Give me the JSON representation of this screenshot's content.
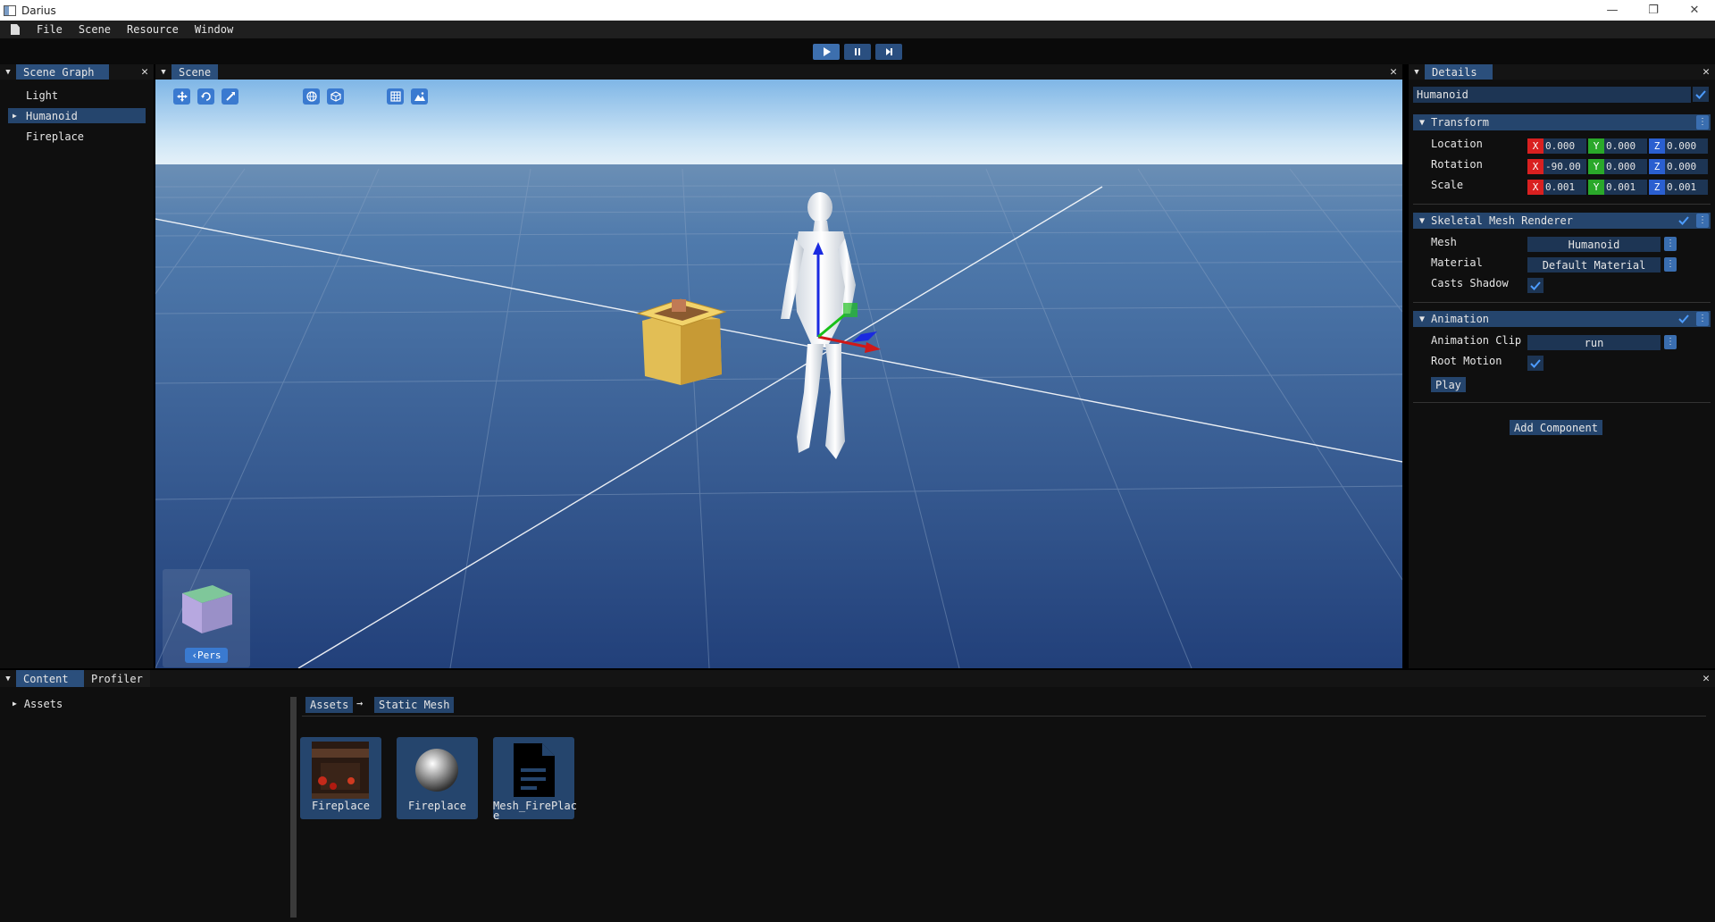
{
  "window": {
    "title": "Darius",
    "controls": [
      "—",
      "❐",
      "✕"
    ]
  },
  "menu": [
    "File",
    "Scene",
    "Resource",
    "Window"
  ],
  "playback": {
    "play": "▶",
    "pause": "⏸",
    "step": "⏭"
  },
  "scene_graph": {
    "tab": "Scene Graph",
    "items": [
      {
        "label": "Light"
      },
      {
        "label": "Humanoid",
        "expander": "▶"
      },
      {
        "label": "Fireplace"
      }
    ]
  },
  "scene": {
    "tab": "Scene",
    "camera_mode": "‹Pers",
    "tools": [
      "move-icon",
      "rotate-icon",
      "scale-icon",
      "global-icon",
      "local-icon",
      "grid-icon",
      "skybox-icon"
    ]
  },
  "details": {
    "tab": "Details",
    "object_name": "Humanoid",
    "transform": {
      "title": "Transform",
      "rows": [
        {
          "label": "Location",
          "x": "0.000",
          "y": "0.000",
          "z": "0.000"
        },
        {
          "label": "Rotation",
          "x": "-90.00",
          "y": "0.000",
          "z": "0.000"
        },
        {
          "label": "Scale",
          "x": "0.001",
          "y": "0.001",
          "z": "0.001"
        }
      ],
      "axes": {
        "x": "X",
        "y": "Y",
        "z": "Z"
      }
    },
    "skeletal": {
      "title": "Skeletal Mesh Renderer",
      "mesh_label": "Mesh",
      "mesh_value": "Humanoid",
      "material_label": "Material",
      "material_value": "Default Material",
      "shadow_label": "Casts Shadow"
    },
    "animation": {
      "title": "Animation",
      "clip_label": "Animation Clip",
      "clip_value": "run",
      "root_label": "Root Motion",
      "play_button": "Play"
    },
    "add_component": "Add Component"
  },
  "content": {
    "tabs": [
      "Content",
      "Profiler"
    ],
    "tree_root": "Assets",
    "breadcrumb": [
      "Assets",
      "Static Mesh"
    ],
    "breadcrumb_sep": "→",
    "assets": [
      {
        "name": "Fireplace",
        "kind": "texture"
      },
      {
        "name": "Fireplace",
        "kind": "material"
      },
      {
        "name": "Mesh_FirePlac\ne",
        "kind": "document"
      }
    ]
  },
  "colors": {
    "accent": "#25456d",
    "tab_active": "#2b4f7c",
    "button": "#3a7ad0",
    "sky_top": "#7fb6e6",
    "floor": "#2e4f86"
  }
}
